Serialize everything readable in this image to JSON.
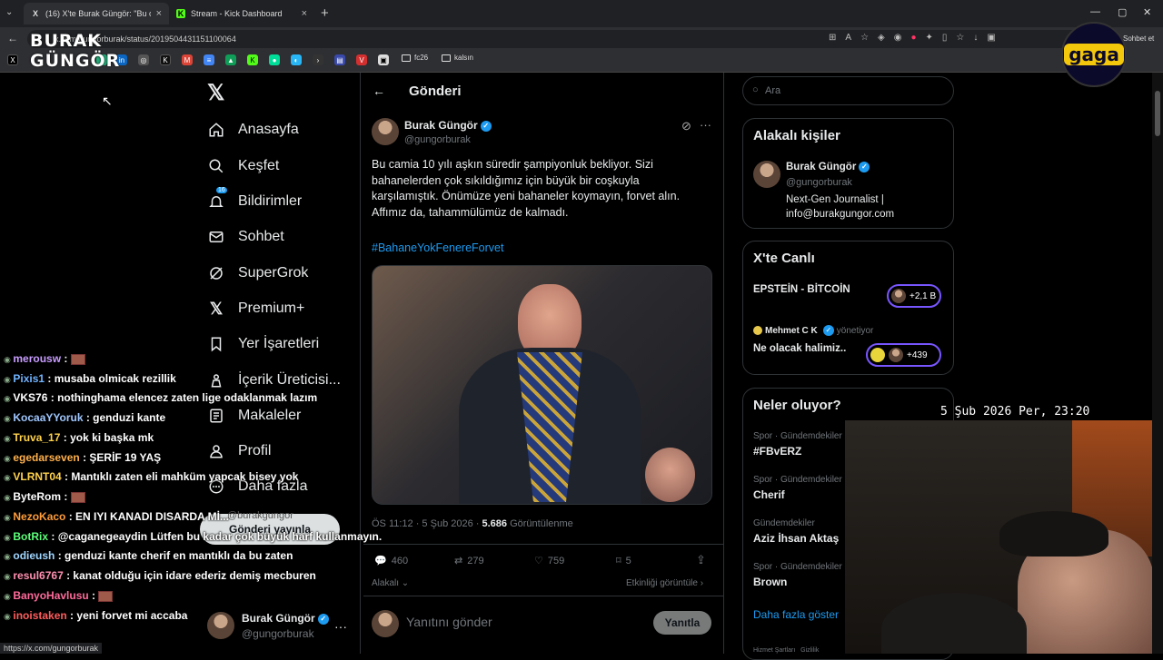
{
  "browser": {
    "tabs": [
      {
        "label": "(16) X'te Burak Güngör: \"Bu camia",
        "favicon": "X"
      },
      {
        "label": "Stream - Kick Dashboard",
        "favicon": "K"
      }
    ],
    "new_tab": "+",
    "url": "x.com/gungorburak/status/2019504431151100064",
    "bookmarks_folders": [
      "fc26",
      "kalsın"
    ],
    "profile_label": "Sohbet et",
    "status_url": "https://x.com/gungorburak"
  },
  "overlay": {
    "streamer_logo_line1": "BURAK",
    "streamer_logo_line2": "GÜNGÖR",
    "brand_badge": "gaga",
    "clock": "5 Şub 2026 Per, 23:20"
  },
  "sidebar": {
    "items": [
      {
        "label": "Anasayfa",
        "icon": "home-icon"
      },
      {
        "label": "Keşfet",
        "icon": "search-icon"
      },
      {
        "label": "Bildirimler",
        "icon": "bell-icon",
        "badge": "16"
      },
      {
        "label": "Sohbet",
        "icon": "mail-icon"
      },
      {
        "label": "SuperGrok",
        "icon": "grok-icon"
      },
      {
        "label": "Premium+",
        "icon": "x-icon"
      },
      {
        "label": "Yer İşaretleri",
        "icon": "bookmark-icon"
      },
      {
        "label": "İçerik Üreticisi...",
        "icon": "creator-icon"
      },
      {
        "label": "Makaleler",
        "icon": "article-icon"
      },
      {
        "label": "Profil",
        "icon": "person-icon"
      },
      {
        "label": "Daha fazla",
        "icon": "more-icon"
      }
    ],
    "post_button": "Gönderi yayınla",
    "account_name": "Burak Güngör",
    "account_handle": "@gungorburak",
    "tooltip_handle": "@burakgungor"
  },
  "post": {
    "header": "Gönderi",
    "author": "Burak Güngör",
    "handle": "@gungorburak",
    "text": "Bu camia 10 yılı aşkın süredir şampiyonluk bekliyor. Sizi bahanelerden çok sıkıldığımız için büyük bir coşkuyla karşılamıştık. Önümüze yeni bahaneler koymayın, forvet alın. Affımız da, tahammülümüz de kalmadı.",
    "hashtag": "#BahaneYokFenereForvet",
    "timestamp": "ÖS 11:12 · 5 Şub 2026 · ",
    "views": "5.686",
    "views_label": "Görüntülenme",
    "replies": "460",
    "reposts": "279",
    "likes": "759",
    "bookmarks": "5",
    "sort_label": "Alakalı",
    "activity_label": "Etkinliği görüntüle",
    "reply_placeholder": "Yanıtını gönder",
    "reply_button": "Yanıtla"
  },
  "right": {
    "search_placeholder": "Ara",
    "related_title": "Alakalı kişiler",
    "related_name": "Burak Güngör",
    "related_handle": "@gungorburak",
    "related_bio": "Next-Gen Journalist | info@burakgungor.com",
    "live_title": "X'te Canlı",
    "live1_title": "EPSTEİN - BİTCOİN",
    "live1_count": "+2,1 B",
    "live2_host": "Mehmet C K",
    "live2_role": "yönetiyor",
    "live2_title": "Ne olacak halimiz..",
    "live2_count": "+439",
    "trends_title": "Neler oluyor?",
    "trends": [
      {
        "category": "Spor · Gündemdekiler",
        "name": "#FBvERZ"
      },
      {
        "category": "Spor · Gündemdekiler",
        "name": "Cherif"
      },
      {
        "category": "Gündemdekiler",
        "name": "Aziz İhsan Aktaş"
      },
      {
        "category": "Spor · Gündemdekiler",
        "name": "Brown"
      }
    ],
    "show_more": "Daha fazla göster",
    "footer": "Hizmet Şartları   Gizlilik"
  },
  "chat": [
    {
      "user": "merousw",
      "color": "#c89cff",
      "msg": "",
      "emote": true
    },
    {
      "user": "Pixis1",
      "color": "#6fb3ff",
      "msg": "musaba olmicak rezillik"
    },
    {
      "user": "VKS76",
      "color": "#ffffff",
      "msg": "nothinghama elencez zaten lige odaklanmak lazım"
    },
    {
      "user": "KocaaYYoruk",
      "color": "#9fc7ff",
      "msg": "genduzi kante"
    },
    {
      "user": "Truva_17",
      "color": "#ffd24d",
      "msg": "yok ki başka mk"
    },
    {
      "user": "egedarseven",
      "color": "#ffb04d",
      "msg": "ŞERİF 19 YAŞ"
    },
    {
      "user": "VLRNT04",
      "color": "#ffd24d",
      "msg": "Mantıklı zaten eli mahküm yapcak bisey yok"
    },
    {
      "user": "ByteRom",
      "color": "#ffffff",
      "msg": "",
      "emote": true
    },
    {
      "user": "NezoKaco",
      "color": "#ff9d3b",
      "msg": "EN IYI KANADI DISARDA Mİ..."
    },
    {
      "user": "BotRix",
      "color": "#5cff7a",
      "msg": "@caganegeaydin Lütfen bu kadar çok büyük harf kullanmayın."
    },
    {
      "user": "odieush",
      "color": "#9fd6ff",
      "msg": "genduzi kante cherif en mantıklı da bu zaten"
    },
    {
      "user": "resul6767",
      "color": "#ff8fb0",
      "msg": "kanat olduğu için idare ederiz demiş mecburen"
    },
    {
      "user": "BanyoHavlusu",
      "color": "#ff6b9b",
      "msg": "",
      "emote": true
    },
    {
      "user": "inoistaken",
      "color": "#ff5c5c",
      "msg": "yeni forvet mi accaba"
    }
  ]
}
